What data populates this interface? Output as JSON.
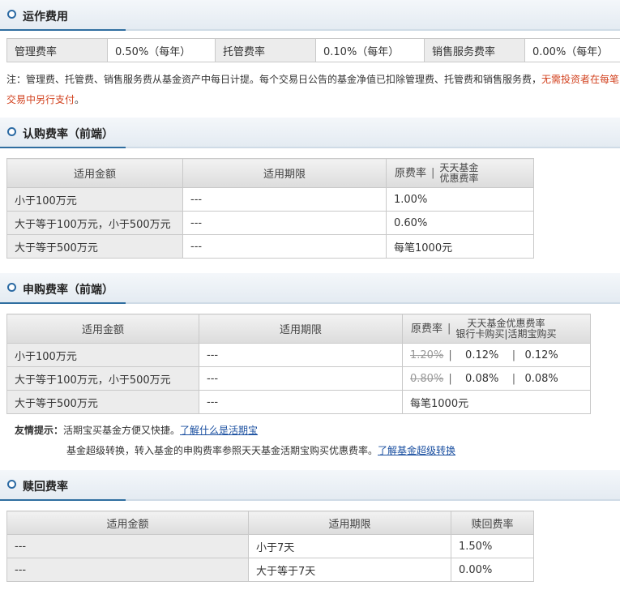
{
  "ops": {
    "title": "运作费用",
    "items": [
      {
        "label": "管理费率",
        "value": "0.50%（每年）"
      },
      {
        "label": "托管费率",
        "value": "0.10%（每年）"
      },
      {
        "label": "销售服务费率",
        "value": "0.00%（每年）"
      }
    ],
    "note_line1": "注：管理费、托管费、销售服务费从基金资产中每日计提。每个交易日公告的基金净值已扣除管理费、托管费和销售服务费，",
    "note_red1": "无需投资者在每笔",
    "note_red2": "交易中另行支付",
    "note_end": "。"
  },
  "subscribe": {
    "title": "认购费率（前端）",
    "headers": [
      "适用金额",
      "适用期限",
      "原费率",
      "天天基金",
      "优惠费率"
    ],
    "rows": [
      {
        "amount": "小于100万元",
        "period": "---",
        "rate": "1.00%"
      },
      {
        "amount": "大于等于100万元，小于500万元",
        "period": "---",
        "rate": "0.60%"
      },
      {
        "amount": "大于等于500万元",
        "period": "---",
        "rate": "每笔1000元"
      }
    ]
  },
  "purchase": {
    "title": "申购费率（前端）",
    "headers": [
      "适用金额",
      "适用期限",
      "原费率",
      "天天基金优惠费率",
      "银行卡购买",
      "活期宝购买"
    ],
    "rows": [
      {
        "amount": "小于100万元",
        "period": "---",
        "orig": "1.20%",
        "bank": "0.12%",
        "huoqi": "0.12%"
      },
      {
        "amount": "大于等于100万元，小于500万元",
        "period": "---",
        "orig": "0.80%",
        "bank": "0.08%",
        "huoqi": "0.08%"
      },
      {
        "amount": "大于等于500万元",
        "period": "---",
        "orig": "每笔1000元"
      }
    ],
    "tip_label": "友情提示：",
    "tip1": "活期宝买基金方便又快捷。",
    "tip1_link": "了解什么是活期宝",
    "tip2": "基金超级转换，转入基金的申购费率参照天天基金活期宝购买优惠费率。",
    "tip2_link": "了解基金超级转换"
  },
  "redeem": {
    "title": "赎回费率",
    "headers": [
      "适用金额",
      "适用期限",
      "赎回费率"
    ],
    "rows": [
      {
        "amount": "---",
        "period": "小于7天",
        "rate": "1.50%"
      },
      {
        "amount": "---",
        "period": "大于等于7天",
        "rate": "0.00%"
      }
    ]
  },
  "colors": {
    "accent": "#2f6ea0",
    "red": "#d2411e",
    "link": "#1a4fa0"
  }
}
